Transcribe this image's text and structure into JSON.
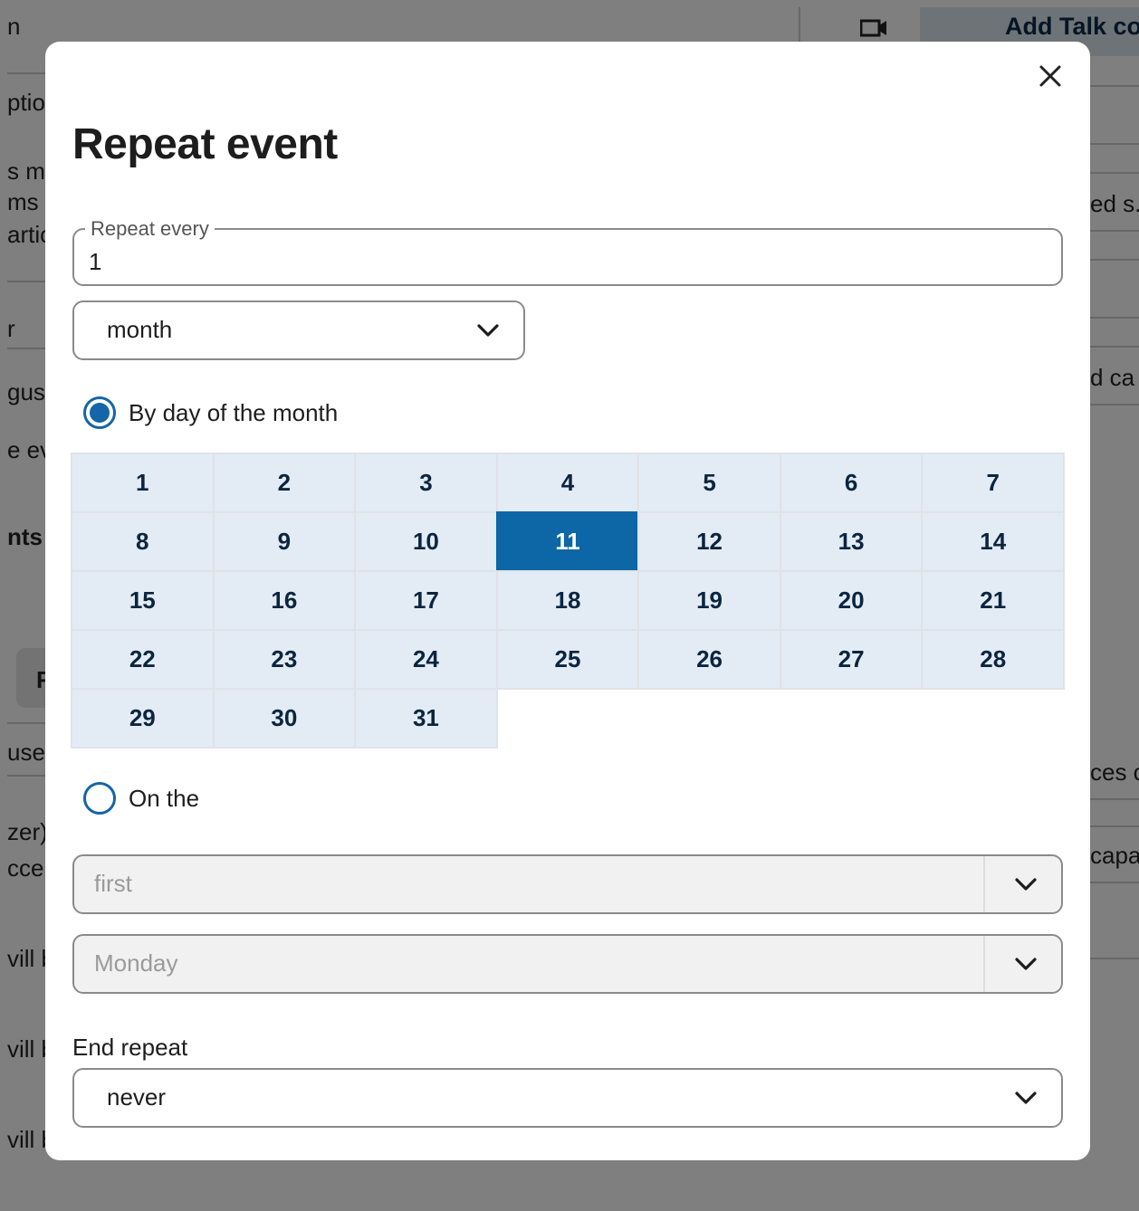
{
  "background": {
    "fragments": [
      "n",
      "ptio",
      "s me",
      "ms",
      "artic",
      "r",
      "gus",
      "e ev",
      "nts",
      "F",
      "use",
      "zer)",
      "cce",
      "vill b",
      "vill b",
      "vill b",
      "ed s.",
      "d ca",
      "ces c",
      "capa"
    ],
    "talk_button_label": "Add Talk co"
  },
  "modal": {
    "title": "Repeat event",
    "close_label": "×",
    "repeat_every": {
      "label": "Repeat every",
      "value": "1"
    },
    "frequency": {
      "selected": "month"
    },
    "by_day_option": {
      "label": "By day of the month",
      "checked": true
    },
    "days": [
      "1",
      "2",
      "3",
      "4",
      "5",
      "6",
      "7",
      "8",
      "9",
      "10",
      "11",
      "12",
      "13",
      "14",
      "15",
      "16",
      "17",
      "18",
      "19",
      "20",
      "21",
      "22",
      "23",
      "24",
      "25",
      "26",
      "27",
      "28",
      "29",
      "30",
      "31"
    ],
    "selected_day": "11",
    "on_the_option": {
      "label": "On the",
      "checked": false
    },
    "ordinal_select": {
      "selected": "first"
    },
    "weekday_select": {
      "selected": "Monday"
    },
    "end_repeat": {
      "label": "End repeat",
      "selected": "never"
    }
  },
  "colors": {
    "accent": "#0d66a5",
    "day_cell_bg": "#e3ebf4",
    "day_text": "#0b2540"
  },
  "icons": {
    "close": "close-icon",
    "chevron": "chevron-down-icon",
    "camera": "video-camera-icon"
  }
}
